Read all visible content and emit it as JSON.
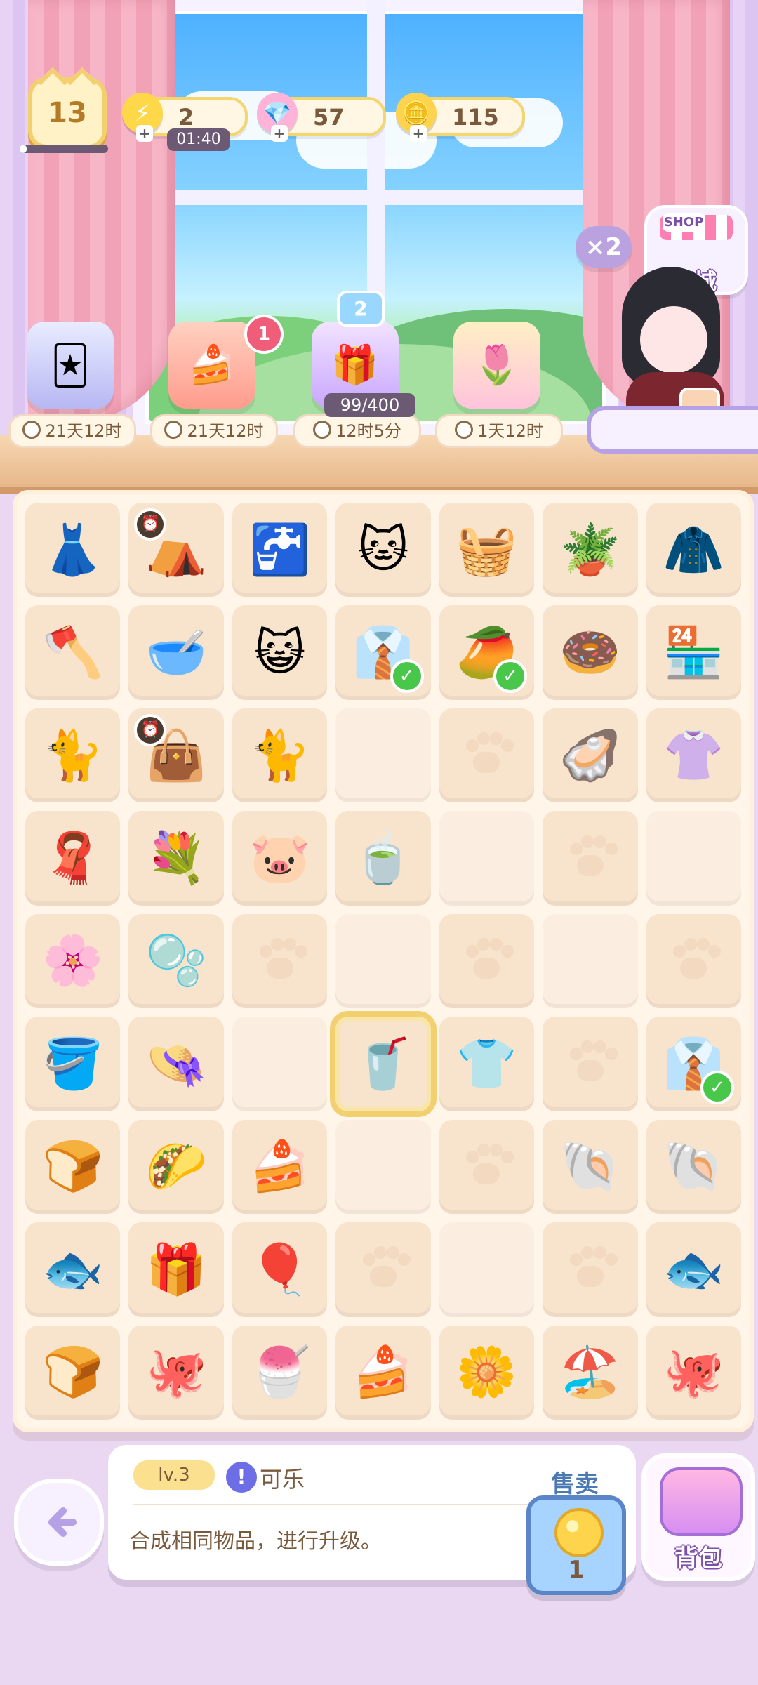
{
  "top_bar": {
    "level": "13",
    "level_progress_fraction": 0.08,
    "energy": {
      "value": "2",
      "timer": "01:40"
    },
    "gems": {
      "value": "57"
    },
    "coins": {
      "value": "115"
    }
  },
  "shop": {
    "multiplier": "×2",
    "sign": "SHOP",
    "label": "商城"
  },
  "events": [
    {
      "timer": "21天12时",
      "icon": "cards-icon"
    },
    {
      "timer": "21天12时",
      "icon": "cake-roll-icon",
      "badge": "1"
    },
    {
      "timer": "12时5分",
      "icon": "gift-chest-icon",
      "progress": "99/400",
      "level": "2"
    },
    {
      "timer": "1天12时",
      "icon": "flower-basket-icon"
    }
  ],
  "board": {
    "rows": 9,
    "cols": 7,
    "cells": [
      {
        "r": 0,
        "c": 0,
        "item": "dress-icon",
        "text": "👗"
      },
      {
        "r": 0,
        "c": 1,
        "item": "tent-icon",
        "text": "⛺",
        "locked": true
      },
      {
        "r": 0,
        "c": 2,
        "item": "water-dispenser-icon",
        "text": "🚰"
      },
      {
        "r": 0,
        "c": 3,
        "item": "cat-icon",
        "text": "🐱"
      },
      {
        "r": 0,
        "c": 4,
        "item": "cushion-icon",
        "text": "🧺"
      },
      {
        "r": 0,
        "c": 5,
        "item": "shelf-icon",
        "text": "🪴"
      },
      {
        "r": 0,
        "c": 6,
        "item": "wardrobe-icon",
        "text": "🧥"
      },
      {
        "r": 1,
        "c": 0,
        "item": "shovel-icon",
        "text": "🪓"
      },
      {
        "r": 1,
        "c": 1,
        "item": "bowl-icon",
        "text": "🥣"
      },
      {
        "r": 1,
        "c": 2,
        "item": "lucky-cat-icon",
        "text": "😺"
      },
      {
        "r": 1,
        "c": 3,
        "item": "outfit-icon",
        "text": "👔",
        "check": true
      },
      {
        "r": 1,
        "c": 4,
        "item": "mango-drink-icon",
        "text": "🥭",
        "check": true
      },
      {
        "r": 1,
        "c": 5,
        "item": "donut-icon",
        "text": "🍩"
      },
      {
        "r": 1,
        "c": 6,
        "item": "vending-machine-icon",
        "text": "🏪"
      },
      {
        "r": 2,
        "c": 0,
        "item": "grey-cat-icon",
        "text": "🐈"
      },
      {
        "r": 2,
        "c": 1,
        "item": "bag-icon",
        "text": "👜",
        "locked": true
      },
      {
        "r": 2,
        "c": 2,
        "item": "white-cat-icon",
        "text": "🐈"
      },
      {
        "r": 2,
        "c": 3,
        "empty": true,
        "light": true
      },
      {
        "r": 2,
        "c": 4,
        "empty": true,
        "paw": true
      },
      {
        "r": 2,
        "c": 5,
        "item": "shell-gem-icon",
        "text": "🦪"
      },
      {
        "r": 2,
        "c": 6,
        "item": "uniform-icon",
        "text": "👚"
      },
      {
        "r": 3,
        "c": 0,
        "item": "towel-icon",
        "text": "🧣"
      },
      {
        "r": 3,
        "c": 1,
        "item": "flower-bouquet-icon",
        "text": "💐"
      },
      {
        "r": 3,
        "c": 2,
        "item": "piggy-bank-icon",
        "text": "🐷"
      },
      {
        "r": 3,
        "c": 3,
        "item": "tea-cup-icon",
        "text": "🍵"
      },
      {
        "r": 3,
        "c": 4,
        "empty": true,
        "light": true
      },
      {
        "r": 3,
        "c": 5,
        "empty": true,
        "paw": true
      },
      {
        "r": 3,
        "c": 6,
        "empty": true,
        "light": true
      },
      {
        "r": 4,
        "c": 0,
        "item": "flower-bed-icon",
        "text": "🌸"
      },
      {
        "r": 4,
        "c": 1,
        "item": "pearl-shell-icon",
        "text": "🫧"
      },
      {
        "r": 4,
        "c": 2,
        "empty": true,
        "paw": true
      },
      {
        "r": 4,
        "c": 3,
        "empty": true,
        "light": true
      },
      {
        "r": 4,
        "c": 4,
        "empty": true,
        "paw": true
      },
      {
        "r": 4,
        "c": 5,
        "empty": true,
        "light": true
      },
      {
        "r": 4,
        "c": 6,
        "empty": true,
        "paw": true
      },
      {
        "r": 5,
        "c": 0,
        "item": "watering-can-icon",
        "text": "🪣"
      },
      {
        "r": 5,
        "c": 1,
        "item": "hat-icon",
        "text": "👒"
      },
      {
        "r": 5,
        "c": 2,
        "empty": true,
        "light": true
      },
      {
        "r": 5,
        "c": 3,
        "item": "cola-icon",
        "text": "🥤",
        "selected": true
      },
      {
        "r": 5,
        "c": 4,
        "item": "sweater-icon",
        "text": "👕"
      },
      {
        "r": 5,
        "c": 5,
        "empty": true,
        "paw": true
      },
      {
        "r": 5,
        "c": 6,
        "item": "outfit-2-icon",
        "text": "👔",
        "check": true
      },
      {
        "r": 6,
        "c": 0,
        "item": "cat-bread-icon",
        "text": "🍞"
      },
      {
        "r": 6,
        "c": 1,
        "item": "taco-cat-icon",
        "text": "🌮"
      },
      {
        "r": 6,
        "c": 2,
        "item": "fruit-cake-icon",
        "text": "🍰"
      },
      {
        "r": 6,
        "c": 3,
        "empty": true,
        "light": true
      },
      {
        "r": 6,
        "c": 4,
        "empty": true,
        "paw": true
      },
      {
        "r": 6,
        "c": 5,
        "item": "seashell-icon",
        "text": "🐚"
      },
      {
        "r": 6,
        "c": 6,
        "item": "conch-icon",
        "text": "🐚"
      },
      {
        "r": 7,
        "c": 0,
        "item": "fish-bowl-icon",
        "text": "🐟"
      },
      {
        "r": 7,
        "c": 1,
        "item": "gift-box-icon",
        "text": "🎁"
      },
      {
        "r": 7,
        "c": 2,
        "item": "balloon-icon",
        "text": "🎈"
      },
      {
        "r": 7,
        "c": 3,
        "empty": true,
        "paw": true
      },
      {
        "r": 7,
        "c": 4,
        "empty": true,
        "light": true
      },
      {
        "r": 7,
        "c": 5,
        "empty": true,
        "paw": true
      },
      {
        "r": 7,
        "c": 6,
        "item": "fish-icon",
        "text": "🐟"
      },
      {
        "r": 8,
        "c": 0,
        "item": "toaster-icon",
        "text": "🍞"
      },
      {
        "r": 8,
        "c": 1,
        "item": "octopus-icon",
        "text": "🐙"
      },
      {
        "r": 8,
        "c": 2,
        "item": "berry-parfait-icon",
        "text": "🍧"
      },
      {
        "r": 8,
        "c": 3,
        "item": "cake-slice-icon",
        "text": "🍰"
      },
      {
        "r": 8,
        "c": 4,
        "item": "gold-flowers-icon",
        "text": "🌼"
      },
      {
        "r": 8,
        "c": 5,
        "item": "sand-shovel-icon",
        "text": "🏖️"
      },
      {
        "r": 8,
        "c": 6,
        "item": "octopus-2-icon",
        "text": "🐙"
      }
    ]
  },
  "info_panel": {
    "level": "lv.3",
    "item_name": "可乐",
    "description": "合成相同物品，进行升级。",
    "sell_label": "售卖",
    "sell_price": "1"
  },
  "bag": {
    "label": "背包"
  }
}
